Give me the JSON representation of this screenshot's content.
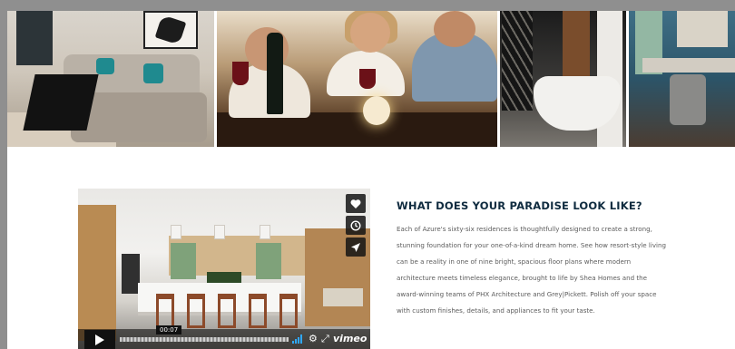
{
  "content": {
    "heading": "WHAT DOES YOUR PARADISE LOOK LIKE?",
    "body": "Each of Azure's sixty-six residences is thoughtfully designed to create a strong, stunning foundation for your one-of-a-kind dream home. See how resort-style living can be a reality in one of nine bright, spacious floor plans where modern architecture meets timeless elegance, brought to life by Shea Homes and the award-winning teams of PHX Architecture and Grey|Pickett. Polish off your space with custom finishes, details, and appliances to fit your taste."
  },
  "video": {
    "timestamp": "00:07",
    "brand": "vimeo",
    "side_icons": [
      "heart-icon",
      "clock-icon",
      "send-icon"
    ],
    "accent_color": "#2fa8ff"
  },
  "banner": {
    "panels": [
      "living-room-photo",
      "dining-photo",
      "bathroom-photo",
      "kitchen-photo"
    ]
  }
}
